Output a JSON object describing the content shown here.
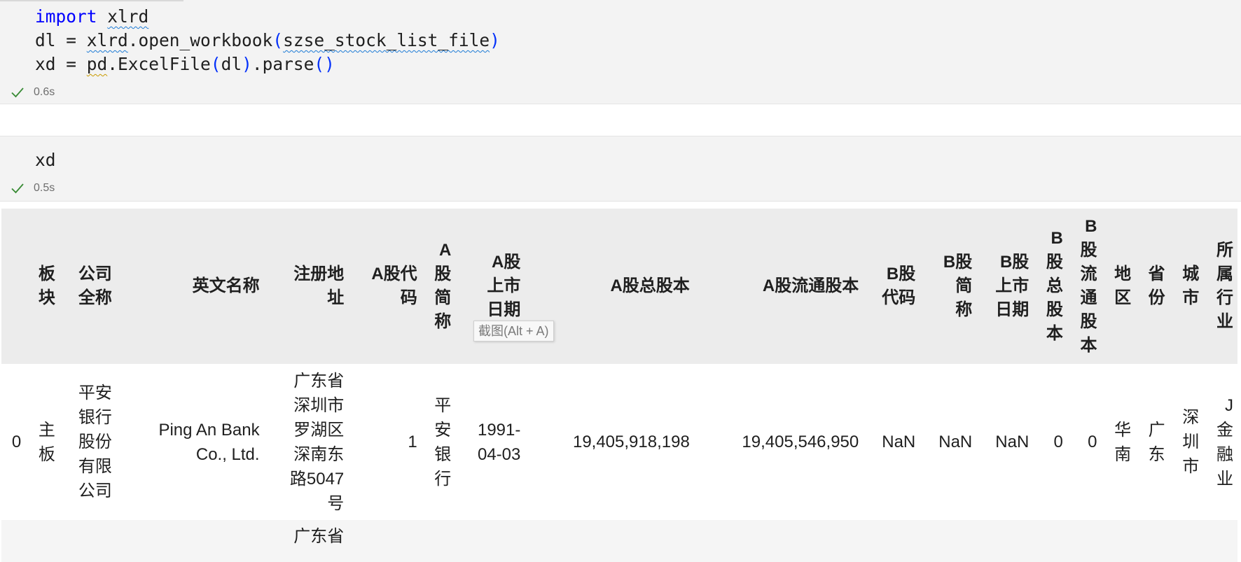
{
  "cells": [
    {
      "code_lines": [
        [
          [
            "kw",
            "import"
          ],
          [
            "t",
            " "
          ],
          [
            "sq",
            "xlrd"
          ]
        ],
        [
          [
            "t",
            "dl = "
          ],
          [
            "sq",
            "xlrd"
          ],
          [
            "t",
            ".open_workbook"
          ],
          [
            "p",
            "("
          ],
          [
            "sq",
            "szse_stock_list_file"
          ],
          [
            "p",
            ")"
          ]
        ],
        [
          [
            "t",
            "xd = "
          ],
          [
            "sqy",
            "pd"
          ],
          [
            "t",
            ".ExcelFile"
          ],
          [
            "p",
            "("
          ],
          [
            "t",
            "dl"
          ],
          [
            "p",
            ")"
          ],
          [
            "t",
            ".parse"
          ],
          [
            "p",
            "()"
          ]
        ]
      ],
      "status": "0.6s"
    },
    {
      "code_lines": [
        [
          [
            "t",
            "xd"
          ]
        ]
      ],
      "status": "0.5s"
    }
  ],
  "table": {
    "headers": [
      "",
      "板\n块",
      "公司\n全称",
      "英文名称",
      "注册地\n址",
      "A股代\n码",
      "A\n股\n简\n称",
      "A股\n上市\n日期",
      "A股总股本",
      "A股流通股本",
      "B股\n代码",
      "B股\n简\n称",
      "B股\n上市\n日期",
      "B\n股\n总\n股\n本",
      "B\n股\n流\n通\n股\n本",
      "地\n区",
      "省\n份",
      "城\n市",
      "所\n属\n行\n业"
    ],
    "rows": [
      [
        "0",
        "主\n板",
        "平安\n银行\n股份\n有限\n公司",
        "Ping An Bank\nCo., Ltd.",
        "广东省\n深圳市\n罗湖区\n深南东\n路5047\n号",
        "1",
        "平\n安\n银\n行",
        "1991-\n04-03",
        "19,405,918,198",
        "19,405,546,950",
        "NaN",
        "NaN",
        "NaN",
        "0",
        "0",
        "华\n南",
        "广\n东",
        "深\n圳\n市",
        "J\n金\n融\n业"
      ],
      [
        "",
        "",
        "",
        "",
        "广东省",
        "",
        "",
        "",
        "",
        "",
        "",
        "",
        "",
        "",
        "",
        "",
        "",
        "",
        ""
      ]
    ]
  },
  "tooltip": "截图(Alt + A)",
  "colors": {
    "keyword": "#0000ff",
    "paren": "#0431fa",
    "check": "#388a34",
    "cell_bg": "#f3f3f3"
  }
}
